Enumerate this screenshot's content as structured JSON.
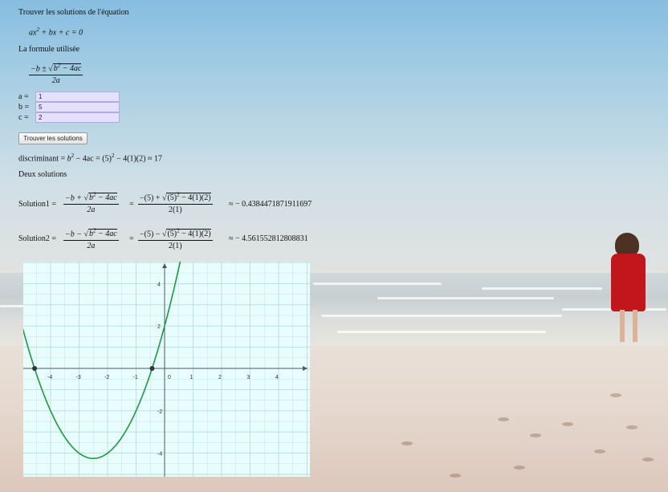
{
  "heading": "Trouver les solutions de l'équation",
  "equation": {
    "a": "ax",
    "sup": "2",
    "rest": " + bx + c = 0"
  },
  "formula_label": "La formule utilisée",
  "formula": {
    "num_pre": "−b ± ",
    "num_sqrt": "b",
    "num_sqrt_sup": "2",
    "num_sqrt_rest": " − 4ac",
    "den": "2a"
  },
  "inputs": [
    {
      "label": "a =",
      "value": "1"
    },
    {
      "label": "b =",
      "value": "5"
    },
    {
      "label": "c =",
      "value": "2"
    }
  ],
  "button_label": "Trouver les solutions",
  "discriminant": {
    "label": "discriminant = ",
    "b": "b",
    "sup": "2",
    "mid": " − 4ac = (5)",
    "sup2": "2",
    "end": " − 4(1)(2) ≈ 17"
  },
  "solutions_count_label": "Deux solutions",
  "solution1": {
    "label": "Solution1 = ",
    "f1_num_pre": "−b + ",
    "f1_num_sqrt": "b",
    "f1_num_sqrt_sup": "2",
    "f1_num_sqrt_rest": " − 4ac",
    "f1_den": "2a",
    "eq": "=",
    "f2_num_pre": "−(5) + ",
    "f2_num_sqrt": "(5)",
    "f2_num_sqrt_sup": "2",
    "f2_num_sqrt_rest": " − 4(1)(2)",
    "f2_den": "2(1)",
    "approx": "≈  − 0.4384471871911697"
  },
  "solution2": {
    "label": "Solution2 = ",
    "f1_num_pre": "−b − ",
    "f1_num_sqrt": "b",
    "f1_num_sqrt_sup": "2",
    "f1_num_sqrt_rest": " − 4ac",
    "f1_den": "2a",
    "eq": "=",
    "f2_num_pre": "−(5) − ",
    "f2_num_sqrt": "(5)",
    "f2_num_sqrt_sup": "2",
    "f2_num_sqrt_rest": " − 4(1)(2)",
    "f2_den": "2(1)",
    "approx": "≈  − 4.561552812808831"
  },
  "chart_data": {
    "type": "line",
    "function": {
      "a": 1,
      "b": 5,
      "c": 2
    },
    "xlim": [
      -5,
      5
    ],
    "ylim": [
      -5,
      5
    ],
    "x_ticks": [
      "-4",
      "-3",
      "-2",
      "-1",
      "0",
      "1",
      "2",
      "3",
      "4"
    ],
    "y_ticks": [
      "4",
      "2",
      "-2",
      "-4"
    ],
    "roots": [
      -0.4384471871911697,
      -4.561552812808831
    ],
    "grid": true,
    "curve_color": "#1e9a3c",
    "axis_color": "#555555",
    "grid_color": "#b9dcdc"
  }
}
